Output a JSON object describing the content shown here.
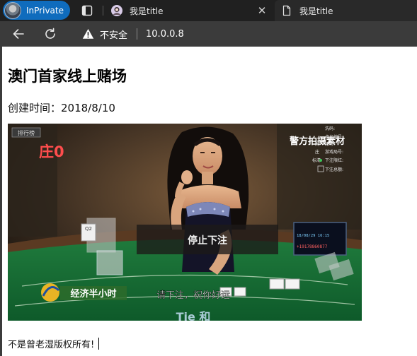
{
  "browser": {
    "inprivate_label": "InPrivate",
    "tabs": [
      {
        "title": "我是title",
        "active": true
      },
      {
        "title": "我是title",
        "active": false
      }
    ],
    "security_text": "不安全",
    "url": "10.0.0.8"
  },
  "page": {
    "heading": "澳门首家线上赌场",
    "created": "创建时间：2018/8/10",
    "footer_text": "不是曾老湿版权所有!",
    "image": {
      "score_label": "庄0",
      "leaderboard": "排行榜",
      "watermark": "警方拍摄素材",
      "stop_bet": "停止下注",
      "show_name": "经济半小时",
      "subtitle": "请下注，祝你好运",
      "table_label": "Tie 和",
      "info_panel": [
        "洗码:",
        "桌台编号:",
        "账号:",
        "游戏局号:",
        "下注限红:",
        "下注总额:"
      ],
      "info_prefix": [
        "",
        "",
        "闲",
        "庄",
        "标清",
        ""
      ],
      "screen_text": [
        "18/08/29 16:15",
        "+19178860877"
      ]
    }
  }
}
